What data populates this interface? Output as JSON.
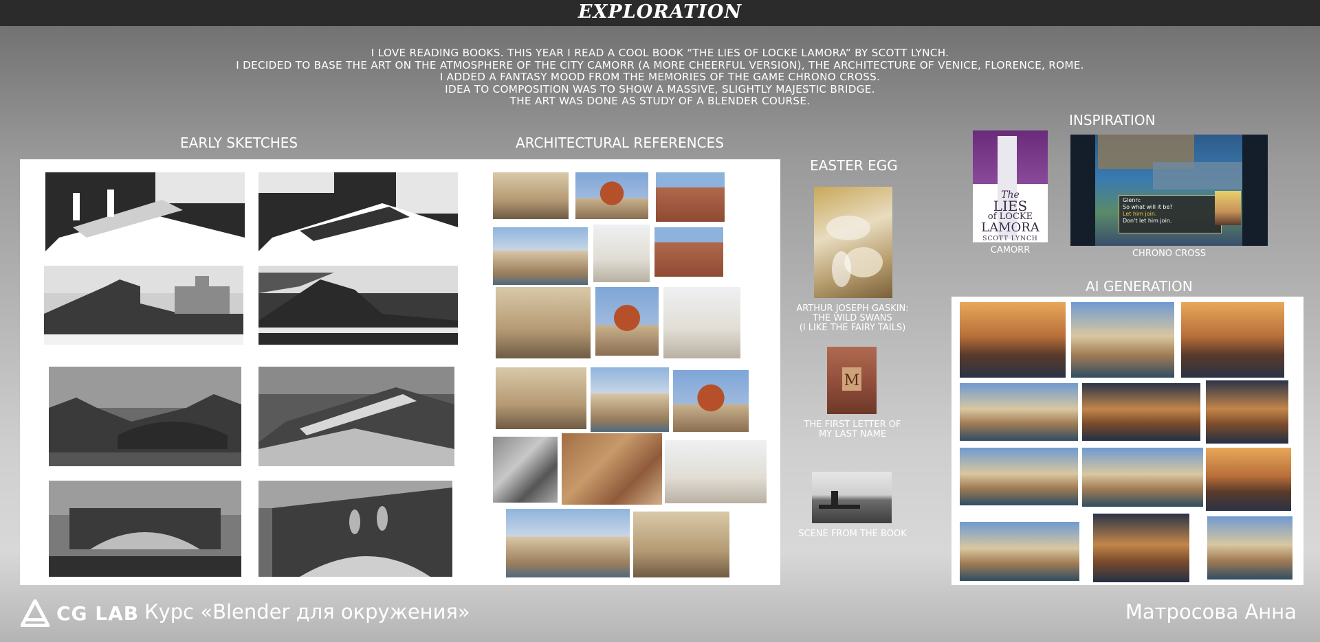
{
  "header": {
    "title": "EXPLORATION"
  },
  "intro": {
    "lines": [
      "I LOVE READING BOOKS. THIS YEAR I READ A COOL BOOK “THE LIES OF LOCKE LAMORA” BY SCOTT LYNCH.",
      "I DECIDED TO BASE THE ART ON THE ATMOSPHERE OF THE CITY CAMORR (A MORE CHEERFUL VERSION), THE ARCHITECTURE OF VENICE, FLORENCE, ROME.",
      "I ADDED A FANTASY MOOD FROM THE MEMORIES OF THE GAME CHRONO CROSS.",
      "IDEA TO COMPOSITION WAS TO SHOW A MASSIVE, SLIGHTLY MAJESTIC BRIDGE.",
      "THE ART WAS DONE AS STUDY OF A BLENDER COURSE."
    ]
  },
  "sections": {
    "early_sketches": "EARLY SKETCHES",
    "architectural_references": "ARCHITECTURAL REFERENCES",
    "easter_egg": "EASTER EGG",
    "inspiration": "INSPIRATION",
    "ai_generation": "AI GENERATION"
  },
  "easter_egg": {
    "caption1_line1": "ARTHUR JOSEPH GASKIN:",
    "caption1_line2": "THE WILD SWANS",
    "caption1_line3": "(I LIKE THE FAIRY TAILS)",
    "caption2_line1": "THE FIRST LETTER OF",
    "caption2_line2": "MY LAST NAME",
    "caption3": "SCENE FROM THE BOOK"
  },
  "inspiration": {
    "book_cover": {
      "title_line1": "The",
      "title_line2": "LIES",
      "title_line3": "of LOCKE",
      "title_line4": "LAMORA",
      "author": "SCOTT LYNCH"
    },
    "caption_camorr": "CAMORR",
    "game_dialog": {
      "line1": "Glenn:",
      "line2": "So what will it be?",
      "line3": "Let him join.",
      "line4": "Don't let him join."
    },
    "caption_chrono": "CHRONO CROSS"
  },
  "footer": {
    "logo_text": "CG LAB",
    "course": "Курс «Blender для окружения»",
    "author": "Матросова Анна"
  },
  "colors": {
    "top_bar": "#2b2b2b",
    "panel": "#ffffff",
    "text": "#ffffff"
  }
}
